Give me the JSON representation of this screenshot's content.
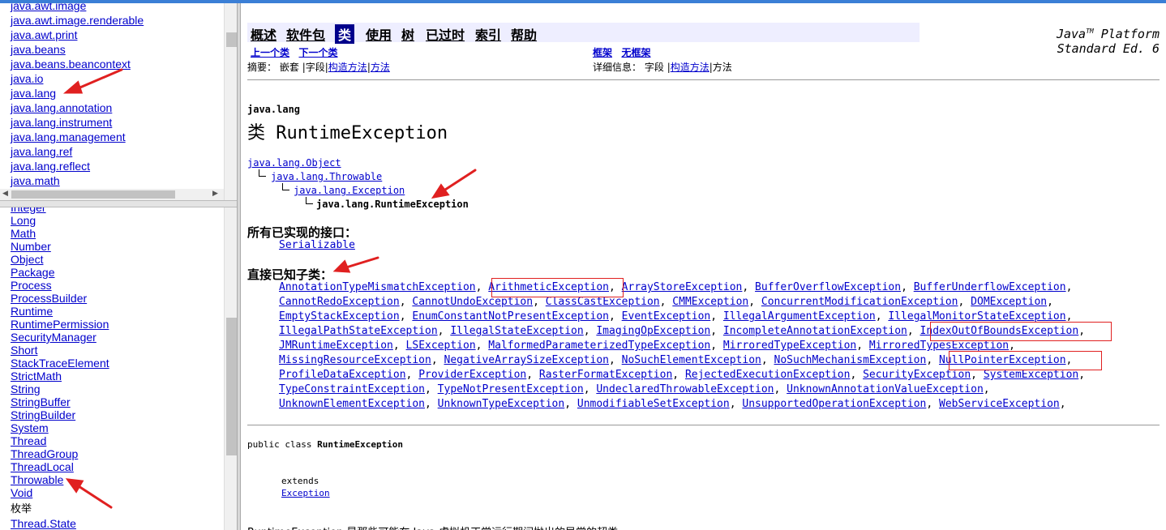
{
  "package_list": [
    "java.awt.image",
    "java.awt.image.renderable",
    "java.awt.print",
    "java.beans",
    "java.beans.beancontext",
    "java.io",
    "java.lang",
    "java.lang.annotation",
    "java.lang.instrument",
    "java.lang.management",
    "java.lang.ref",
    "java.lang.reflect",
    "java.math"
  ],
  "class_list": [
    "Integer",
    "Long",
    "Math",
    "Number",
    "Object",
    "Package",
    "Process",
    "ProcessBuilder",
    "Runtime",
    "RuntimePermission",
    "SecurityManager",
    "Short",
    "StackTraceElement",
    "StrictMath",
    "String",
    "StringBuffer",
    "StringBuilder",
    "System",
    "Thread",
    "ThreadGroup",
    "ThreadLocal",
    "Throwable",
    "Void"
  ],
  "enum_heading": "枚举",
  "enum_list": [
    "Thread.State"
  ],
  "nav": {
    "items": [
      "概述",
      "软件包",
      "类",
      "使用",
      "树",
      "已过时",
      "索引",
      "帮助"
    ],
    "current": "类",
    "prev_class": "上一个类",
    "next_class": "下一个类",
    "frames": "框架",
    "no_frames": "无框架",
    "summary_prefix": "摘要：",
    "summary_nested": "嵌套",
    "summary_field": "字段",
    "summary_ctor": "构造方法",
    "summary_method": "方法",
    "detail_prefix": "详细信息：",
    "detail_field": "字段",
    "detail_ctor": "构造方法",
    "detail_method": "方法",
    "separator": "|"
  },
  "brand": {
    "line1_a": "Java",
    "line1_sup": "TM",
    "line1_b": " Platform",
    "line2": "Standard Ed. 6"
  },
  "package_name": "java.lang",
  "class_title": "类 RuntimeException",
  "hierarchy": [
    "java.lang.Object",
    "java.lang.Throwable",
    "java.lang.Exception",
    "java.lang.RuntimeException"
  ],
  "implemented_label": "所有已实现的接口：",
  "implemented": [
    "Serializable"
  ],
  "subclasses_label": "直接已知子类：",
  "subclass_rows": [
    [
      "AnnotationTypeMismatchException",
      "ArithmeticException",
      "ArrayStoreException",
      "BufferOverflowException",
      "BufferUnderflowException"
    ],
    [
      "CannotRedoException",
      "CannotUndoException",
      "ClassCastException",
      "CMMException",
      "ConcurrentModificationException",
      "DOMException"
    ],
    [
      "EmptyStackException",
      "EnumConstantNotPresentException",
      "EventException",
      "IllegalArgumentException",
      "IllegalMonitorStateException"
    ],
    [
      "IllegalPathStateException",
      "IllegalStateException",
      "ImagingOpException",
      "IncompleteAnnotationException",
      "IndexOutOfBoundsException"
    ],
    [
      "JMRuntimeException",
      "LSException",
      "MalformedParameterizedTypeException",
      "MirroredTypeException",
      "MirroredTypesException"
    ],
    [
      "MissingResourceException",
      "NegativeArraySizeException",
      "NoSuchElementException",
      "NoSuchMechanismException",
      "NullPointerException"
    ],
    [
      "ProfileDataException",
      "ProviderException",
      "RasterFormatException",
      "RejectedExecutionException",
      "SecurityException",
      "SystemException"
    ],
    [
      "TypeConstraintException",
      "TypeNotPresentException",
      "UndeclaredThrowableException",
      "UnknownAnnotationValueException"
    ],
    [
      "UnknownElementException",
      "UnknownTypeException",
      "UnmodifiableSetException",
      "UnsupportedOperationException",
      "WebServiceException"
    ]
  ],
  "declaration": {
    "prefix": "public class ",
    "name": "RuntimeException",
    "extends_kw": "extends",
    "super": "Exception"
  },
  "description_cut": "RuntimeException 是那些可能在 Java 虚拟机正常运行期间抛出的异常的超类。",
  "colors": {
    "link": "#0000cc",
    "nav_bg": "#eeeeff",
    "nav_current": "#00008b",
    "annotation": "#e02020"
  }
}
